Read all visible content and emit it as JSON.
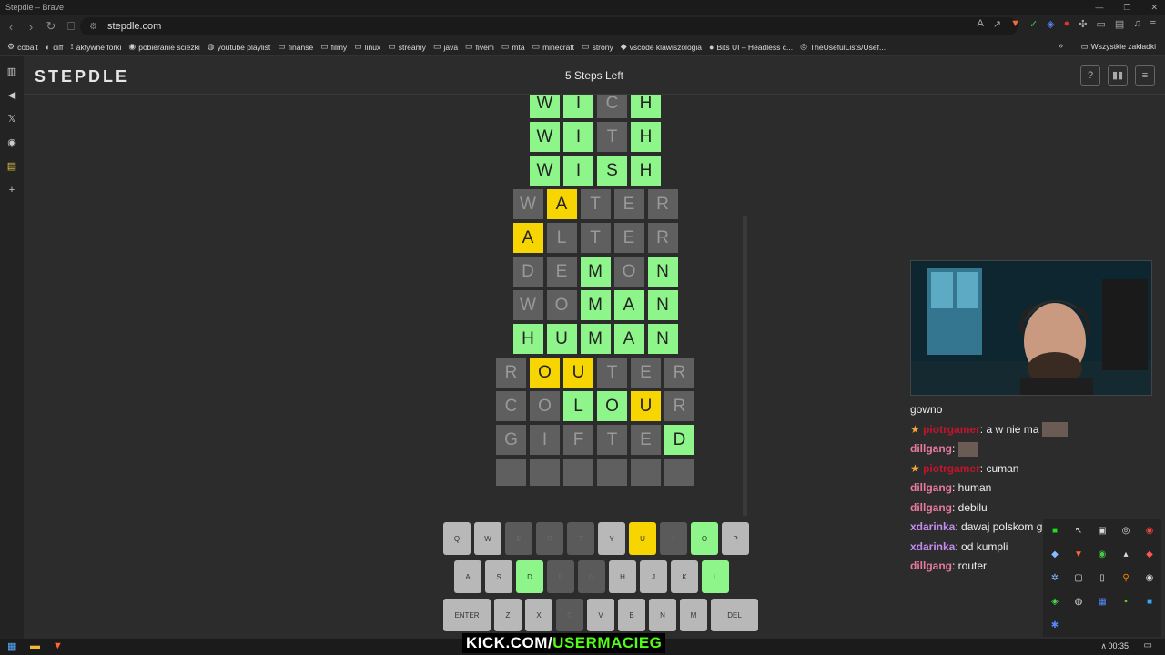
{
  "window": {
    "title": "Stepdle – Brave"
  },
  "browser": {
    "url": "stepdle.com",
    "bookmarks": [
      "cobalt",
      "diff",
      "aktywne forki",
      "pobieranie sciezki",
      "youtube playlist",
      "finanse",
      "filmy",
      "linux",
      "streamy",
      "java",
      "fivem",
      "mta",
      "minecraft",
      "strony",
      "vscode klawiszologia",
      "Bits UI – Headless c...",
      "TheUsefulLists/Usef..."
    ],
    "bookmarks_more": "»",
    "all_bookmarks": "Wszystkie zakładki"
  },
  "app": {
    "logo": "STEPDLE",
    "steps_left": "5 Steps Left",
    "header_buttons": [
      "?",
      "▮▮",
      "≡"
    ]
  },
  "board": {
    "rows": [
      {
        "letters": [
          "W",
          "I",
          "C",
          "H"
        ],
        "states": [
          "g",
          "g",
          "a",
          "g"
        ]
      },
      {
        "letters": [
          "W",
          "I",
          "T",
          "H"
        ],
        "states": [
          "g",
          "g",
          "a",
          "g"
        ]
      },
      {
        "letters": [
          "W",
          "I",
          "S",
          "H"
        ],
        "states": [
          "g",
          "g",
          "g",
          "g"
        ]
      },
      {
        "letters": [
          "W",
          "A",
          "T",
          "E",
          "R"
        ],
        "states": [
          "a",
          "y",
          "a",
          "a",
          "a"
        ]
      },
      {
        "letters": [
          "A",
          "L",
          "T",
          "E",
          "R"
        ],
        "states": [
          "y",
          "a",
          "a",
          "a",
          "a"
        ]
      },
      {
        "letters": [
          "D",
          "E",
          "M",
          "O",
          "N"
        ],
        "states": [
          "a",
          "a",
          "g",
          "a",
          "g"
        ]
      },
      {
        "letters": [
          "W",
          "O",
          "M",
          "A",
          "N"
        ],
        "states": [
          "a",
          "a",
          "g",
          "g",
          "g"
        ]
      },
      {
        "letters": [
          "H",
          "U",
          "M",
          "A",
          "N"
        ],
        "states": [
          "g",
          "g",
          "g",
          "g",
          "g"
        ]
      },
      {
        "letters": [
          "R",
          "O",
          "U",
          "T",
          "E",
          "R"
        ],
        "states": [
          "a",
          "y",
          "y",
          "a",
          "a",
          "a"
        ]
      },
      {
        "letters": [
          "C",
          "O",
          "L",
          "O",
          "U",
          "R"
        ],
        "states": [
          "a",
          "a",
          "g",
          "g",
          "y",
          "a"
        ]
      },
      {
        "letters": [
          "G",
          "I",
          "F",
          "T",
          "E",
          "D"
        ],
        "states": [
          "a",
          "a",
          "a",
          "a",
          "a",
          "g"
        ]
      },
      {
        "letters": [
          "",
          "",
          "",
          "",
          "",
          ""
        ],
        "states": [
          "e",
          "e",
          "e",
          "e",
          "e",
          "e"
        ]
      }
    ]
  },
  "keyboard": {
    "rows": [
      [
        {
          "k": "Q",
          "s": ""
        },
        {
          "k": "W",
          "s": ""
        },
        {
          "k": "E",
          "s": "a"
        },
        {
          "k": "R",
          "s": "a"
        },
        {
          "k": "T",
          "s": "a"
        },
        {
          "k": "Y",
          "s": ""
        },
        {
          "k": "U",
          "s": "y"
        },
        {
          "k": "I",
          "s": "a"
        },
        {
          "k": "O",
          "s": "g"
        },
        {
          "k": "P",
          "s": ""
        }
      ],
      [
        {
          "k": "A",
          "s": ""
        },
        {
          "k": "S",
          "s": ""
        },
        {
          "k": "D",
          "s": "g"
        },
        {
          "k": "F",
          "s": "a"
        },
        {
          "k": "G",
          "s": "a"
        },
        {
          "k": "H",
          "s": ""
        },
        {
          "k": "J",
          "s": ""
        },
        {
          "k": "K",
          "s": ""
        },
        {
          "k": "L",
          "s": "g"
        }
      ],
      [
        {
          "k": "ENTER",
          "s": "",
          "wide": true
        },
        {
          "k": "Z",
          "s": ""
        },
        {
          "k": "X",
          "s": ""
        },
        {
          "k": "C",
          "s": "a"
        },
        {
          "k": "V",
          "s": ""
        },
        {
          "k": "B",
          "s": ""
        },
        {
          "k": "N",
          "s": ""
        },
        {
          "k": "M",
          "s": ""
        },
        {
          "k": "DEL",
          "s": "",
          "wide": true
        }
      ]
    ]
  },
  "chat": [
    {
      "user": "",
      "text": "gowno",
      "color": "#eeeeee",
      "star": false
    },
    {
      "user": "piotrgamer",
      "text": ": a w nie ma",
      "color": "#c4142c",
      "star": true
    },
    {
      "user": "dillgang",
      "text": ":",
      "color": "#e87aa0",
      "star": false
    },
    {
      "user": "piotrgamer",
      "text": ": cuman",
      "color": "#c4142c",
      "star": true
    },
    {
      "user": "dillgang",
      "text": ": human",
      "color": "#e87aa0",
      "star": false
    },
    {
      "user": "dillgang",
      "text": ": debilu",
      "color": "#e87aa0",
      "star": false
    },
    {
      "user": "xdarinka",
      "text": ": dawaj polskom greslowna",
      "color": "#c58cf0",
      "star": false
    },
    {
      "user": "xdarinka",
      "text": ": od kumpli",
      "color": "#c58cf0",
      "star": false
    },
    {
      "user": "dillgang",
      "text": ": router",
      "color": "#e87aa0",
      "star": false
    }
  ],
  "overlay": {
    "kick_prefix": "KICK.COM/",
    "kick_user": "USERMACIEG"
  },
  "taskbar": {
    "time": "00:35"
  },
  "colors": {
    "green": "#8ef58a",
    "yellow": "#f7d500",
    "absent": "#5f5f5f"
  }
}
